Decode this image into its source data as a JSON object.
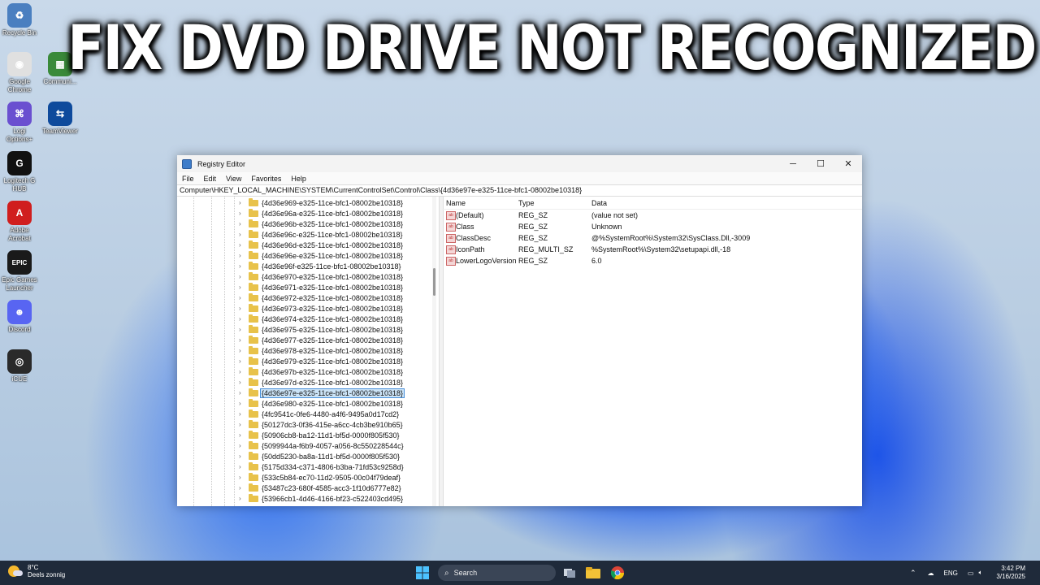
{
  "headline": "FIX DVD DRIVE NOT RECOGNIZED",
  "desktop_icons": [
    {
      "label": "Recycle Bin",
      "color": "#4a7fc0",
      "glyph": "♻"
    },
    {
      "label": "Google Chrome",
      "color": "#e0e0e0",
      "glyph": "◉"
    },
    {
      "label": "Communi...",
      "color": "#3a8a3a",
      "glyph": "▦"
    },
    {
      "label": "Logi Options+",
      "color": "#6a4fd0",
      "glyph": "⌘"
    },
    {
      "label": "TeamViewer",
      "color": "#0e4a9c",
      "glyph": "⇆"
    },
    {
      "label": "Logitech G HUB",
      "color": "#111111",
      "glyph": "G"
    },
    {
      "label": "Adobe Acrobat",
      "color": "#d01e1e",
      "glyph": "A"
    },
    {
      "label": "Epic Games Launcher",
      "color": "#1a1a1a",
      "glyph": "EPIC"
    },
    {
      "label": "Discord",
      "color": "#5865f2",
      "glyph": "☻"
    },
    {
      "label": "iCUE",
      "color": "#2a2a2a",
      "glyph": "◎"
    }
  ],
  "window": {
    "title": "Registry Editor",
    "menu": [
      "File",
      "Edit",
      "View",
      "Favorites",
      "Help"
    ],
    "address": "Computer\\HKEY_LOCAL_MACHINE\\SYSTEM\\CurrentControlSet\\Control\\Class\\{4d36e97e-e325-11ce-bfc1-08002be10318}",
    "tree_items": [
      "{4d36e969-e325-11ce-bfc1-08002be10318}",
      "{4d36e96a-e325-11ce-bfc1-08002be10318}",
      "{4d36e96b-e325-11ce-bfc1-08002be10318}",
      "{4d36e96c-e325-11ce-bfc1-08002be10318}",
      "{4d36e96d-e325-11ce-bfc1-08002be10318}",
      "{4d36e96e-e325-11ce-bfc1-08002be10318}",
      "{4d36e96f-e325-11ce-bfc1-08002be10318}",
      "{4d36e970-e325-11ce-bfc1-08002be10318}",
      "{4d36e971-e325-11ce-bfc1-08002be10318}",
      "{4d36e972-e325-11ce-bfc1-08002be10318}",
      "{4d36e973-e325-11ce-bfc1-08002be10318}",
      "{4d36e974-e325-11ce-bfc1-08002be10318}",
      "{4d36e975-e325-11ce-bfc1-08002be10318}",
      "{4d36e977-e325-11ce-bfc1-08002be10318}",
      "{4d36e978-e325-11ce-bfc1-08002be10318}",
      "{4d36e979-e325-11ce-bfc1-08002be10318}",
      "{4d36e97b-e325-11ce-bfc1-08002be10318}",
      "{4d36e97d-e325-11ce-bfc1-08002be10318}",
      "{4d36e97e-e325-11ce-bfc1-08002be10318}",
      "{4d36e980-e325-11ce-bfc1-08002be10318}",
      "{4fc9541c-0fe6-4480-a4f6-9495a0d17cd2}",
      "{50127dc3-0f36-415e-a6cc-4cb3be910b65}",
      "{50906cb8-ba12-11d1-bf5d-0000f805f530}",
      "{5099944a-f6b9-4057-a056-8c550228544c}",
      "{50dd5230-ba8a-11d1-bf5d-0000f805f530}",
      "{5175d334-c371-4806-b3ba-71fd53c9258d}",
      "{533c5b84-ec70-11d2-9505-00c04f79deaf}",
      "{53487c23-680f-4585-acc3-1f10d6777e82}",
      "{53966cb1-4d46-4166-bf23-c522403cd495}"
    ],
    "selected_index": 18,
    "columns": [
      "Name",
      "Type",
      "Data"
    ],
    "values": [
      {
        "name": "(Default)",
        "type": "REG_SZ",
        "data": "(value not set)",
        "kind": "string"
      },
      {
        "name": "Class",
        "type": "REG_SZ",
        "data": "Unknown",
        "kind": "string"
      },
      {
        "name": "ClassDesc",
        "type": "REG_SZ",
        "data": "@%SystemRoot%\\System32\\SysClass.Dll,-3009",
        "kind": "string"
      },
      {
        "name": "IconPath",
        "type": "REG_MULTI_SZ",
        "data": "%SystemRoot%\\System32\\setupapi.dll,-18",
        "kind": "string"
      },
      {
        "name": "LowerLogoVersion",
        "type": "REG_SZ",
        "data": "6.0",
        "kind": "string"
      }
    ]
  },
  "taskbar": {
    "weather_temp": "8°C",
    "weather_desc": "Deels zonnig",
    "search_label": "Search",
    "language": "ENG",
    "time": "3:42 PM",
    "date": "3/16/2025"
  }
}
